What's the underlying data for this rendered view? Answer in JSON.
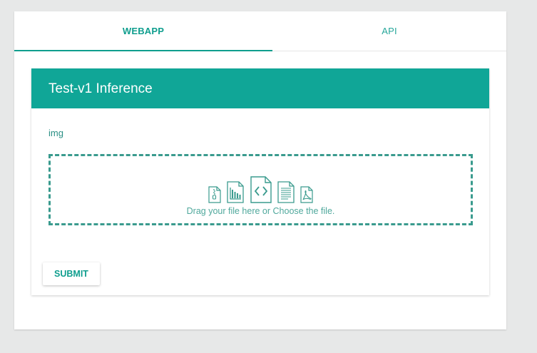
{
  "tabs": [
    {
      "label": "WEBAPP",
      "active": true
    },
    {
      "label": "API",
      "active": false
    }
  ],
  "panel": {
    "title": "Test-v1 Inference"
  },
  "form": {
    "field_label": "img",
    "dropzone_text": "Drag your file here or Choose the file.",
    "dropzone_icons": [
      "file-zip-icon",
      "file-chart-icon",
      "file-code-icon",
      "file-text-icon",
      "file-pdf-icon"
    ],
    "submit_label": "SUBMIT"
  },
  "colors": {
    "accent": "#10a697",
    "background": "#e7e8e8",
    "dashed_border": "#3a9b8e"
  }
}
